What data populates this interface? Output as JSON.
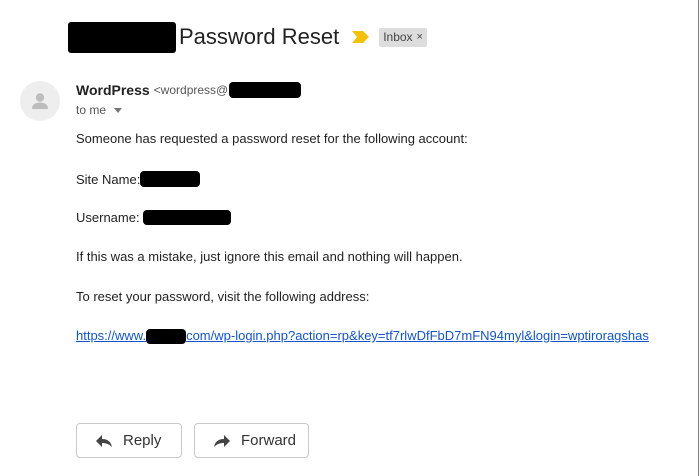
{
  "subject": {
    "title": "Password Reset",
    "importance_icon": "importance-marker-icon",
    "label": "Inbox",
    "label_close": "×"
  },
  "sender": {
    "avatar_icon": "person-icon",
    "name": "WordPress",
    "email_prefix": "<wordpress@",
    "recipient": "to me",
    "recipient_caret_icon": "caret-down-icon"
  },
  "body": {
    "line1": "Someone has requested a password reset for the following account:",
    "site_label": "Site Name:",
    "username_label": "Username:",
    "mistake_line": "If this was a mistake, just ignore this email and nothing will happen.",
    "reset_line": "To reset your password, visit the following address:",
    "link_prefix": "https://www.",
    "link_suffix": "com/wp-login.php?action=rp&key=tf7rlwDfFbD7mFN94myl&login=wptiroragshas"
  },
  "actions": {
    "reply_label": "Reply",
    "reply_icon": "reply-arrow-icon",
    "forward_label": "Forward",
    "forward_icon": "forward-arrow-icon"
  },
  "colors": {
    "link": "#1155cc",
    "importance": "#f4c20d",
    "label_chip_bg": "#dddddd"
  }
}
